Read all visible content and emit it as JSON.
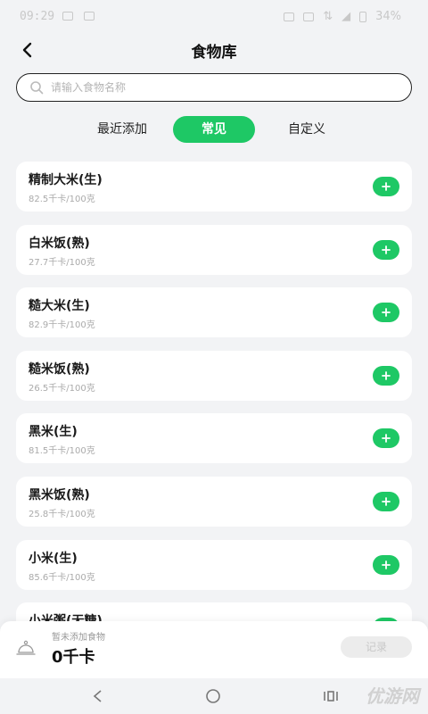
{
  "status_bar": {
    "time": "09:29",
    "battery": "34%"
  },
  "header": {
    "title": "食物库"
  },
  "search": {
    "placeholder": "请输入食物名称"
  },
  "tabs": [
    {
      "label": "最近添加",
      "active": false
    },
    {
      "label": "常见",
      "active": true
    },
    {
      "label": "自定义",
      "active": false
    }
  ],
  "foods": [
    {
      "name": "精制大米(生)",
      "calories": "82.5千卡/100克"
    },
    {
      "name": "白米饭(熟)",
      "calories": "27.7千卡/100克"
    },
    {
      "name": "糙大米(生)",
      "calories": "82.9千卡/100克"
    },
    {
      "name": "糙米饭(熟)",
      "calories": "26.5千卡/100克"
    },
    {
      "name": "黑米(生)",
      "calories": "81.5千卡/100克"
    },
    {
      "name": "黑米饭(熟)",
      "calories": "25.8千卡/100克"
    },
    {
      "name": "小米(生)",
      "calories": "85.6千卡/100克"
    },
    {
      "name": "小米粥(无糖)",
      "calories": ""
    }
  ],
  "bottom": {
    "status_text": "暂未添加食物",
    "total": "0千卡",
    "record_label": "记录"
  },
  "watermark": "优游网",
  "colors": {
    "accent": "#1ec865",
    "background": "#f2f3f5"
  },
  "icons": {
    "back": "chevron-left-icon",
    "search": "search-icon",
    "add": "plus-icon",
    "tray": "food-tray-icon"
  }
}
